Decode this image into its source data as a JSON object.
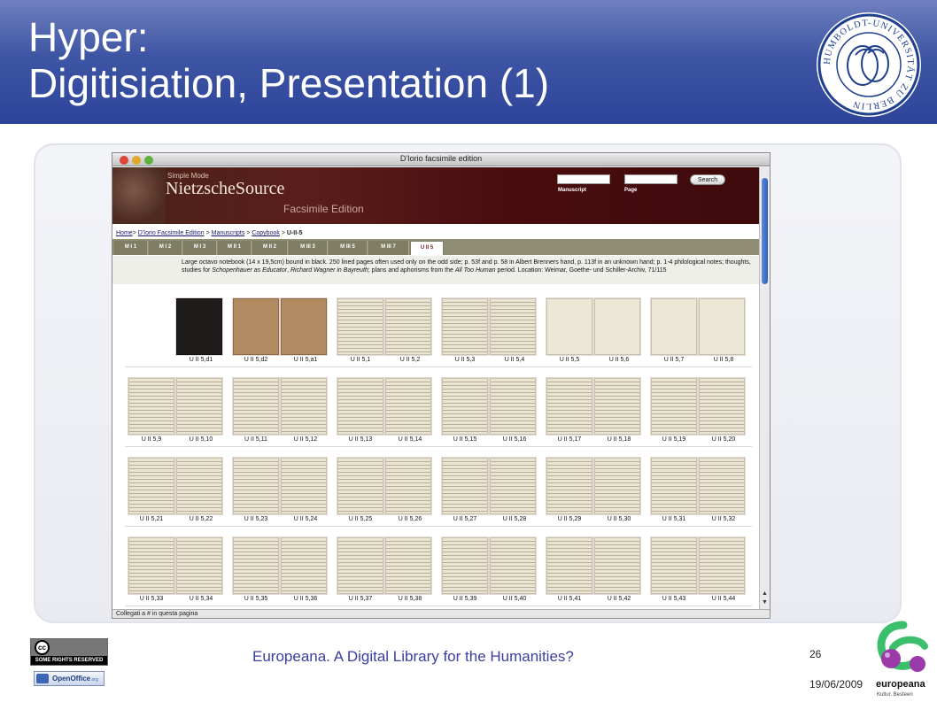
{
  "slide": {
    "title_line1": "Hyper:",
    "title_line2": "Digitisiation, Presentation (1)",
    "footer_text": "Europeana. A Digital Library for the Humanities?",
    "page_number": "26",
    "date": "19/06/2009",
    "accent_color": "#3e55a4",
    "footer_text_color": "#3a3ea0"
  },
  "logos": {
    "seal": {
      "icon": "humboldt-seal-icon",
      "ring_text": "HUMBOLDT-UNIVERSITÄT ZU BERLIN"
    },
    "cc_badge": {
      "icon": "cc-icon",
      "symbol": "cc",
      "text": "SOME RIGHTS RESERVED"
    },
    "openoffice": {
      "icon": "openoffice-icon",
      "text": "OpenOffice",
      "suffix": ".org"
    },
    "europeana": {
      "icon": "europeana-logo-icon",
      "text": "europeana",
      "subtext": "Kultur. Besteen"
    }
  },
  "browser": {
    "window_title": "D'Iorio facsimile edition",
    "status_text": "Collegati a # in questa pagina"
  },
  "site": {
    "mode": "Simple Mode",
    "name": "NietzscheSource",
    "edition": "Facsimile Edition",
    "manuscript_label": "Manuscript",
    "page_label": "Page",
    "search_label": "Search",
    "manuscript_value": "",
    "page_value": ""
  },
  "breadcrumb": {
    "home": "Home",
    "sep": ">",
    "item1": "D'Iorio Facsimile Edition",
    "item2": "Manuscripts",
    "item3": "Copybook",
    "current": "U-II-5"
  },
  "tabs": [
    "M I 1",
    "M I 2",
    "M I 3",
    "M II 1",
    "M II 2",
    "M III 3",
    "M III 5",
    "M III 7",
    "U II 5"
  ],
  "active_tab": "U II 5",
  "description": {
    "part1": "Large octavo notebook (14 x 19,5cm) bound in black. 250 lined pages often used only on the odd side; p. 53f and p. 58 in Albert Brenners hand, p. 113f in an unknown hand; p. 1-4 philological notes; thoughts, studies for ",
    "title1": "Schopenhauer as Educator",
    "part2": ", ",
    "title2": "Richard Wagner in Bayreuth",
    "part3": "; plans and aphorisms from the ",
    "title3": "All Too Human",
    "part4": " period. Location: Weimar, Goethe- und Schiller-Archiv, 71/115"
  },
  "thumbnails": [
    [
      "",
      "U II 5,d1"
    ],
    [
      "U II 5,d2",
      "U II 5,a1"
    ],
    [
      "U II 5,1",
      "U II 5,2"
    ],
    [
      "U II 5,3",
      "U II 5,4"
    ],
    [
      "U II 5,5",
      "U II 5,6"
    ],
    [
      "U II 5,7",
      "U II 5,8"
    ],
    [
      "U II 5,9",
      "U II 5,10"
    ],
    [
      "U II 5,11",
      "U II 5,12"
    ],
    [
      "U II 5,13",
      "U II 5,14"
    ],
    [
      "U II 5,15",
      "U II 5,16"
    ],
    [
      "U II 5,17",
      "U II 5,18"
    ],
    [
      "U II 5,19",
      "U II 5,20"
    ],
    [
      "U II 5,21",
      "U II 5,22"
    ],
    [
      "U II 5,23",
      "U II 5,24"
    ],
    [
      "U II 5,25",
      "U II 5,26"
    ],
    [
      "U II 5,27",
      "U II 5,28"
    ],
    [
      "U II 5,29",
      "U II 5,30"
    ],
    [
      "U II 5,31",
      "U II 5,32"
    ],
    [
      "U II 5,33",
      "U II 5,34"
    ],
    [
      "U II 5,35",
      "U II 5,36"
    ],
    [
      "U II 5,37",
      "U II 5,38"
    ],
    [
      "U II 5,39",
      "U II 5,40"
    ],
    [
      "U II 5,41",
      "U II 5,42"
    ],
    [
      "U II 5,43",
      "U II 5,44"
    ]
  ]
}
